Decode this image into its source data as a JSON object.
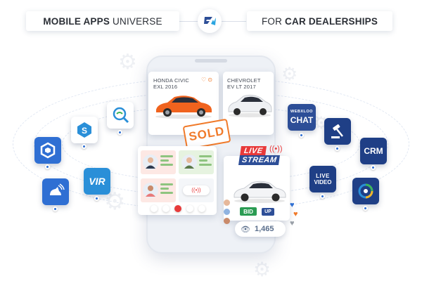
{
  "header": {
    "left_bold": "MOBILE APPS",
    "left_thin": "UNIVERSE",
    "right_thin": "FOR",
    "right_bold": "CAR DEALERSHIPS",
    "logo_icon": "brand-logo-icon"
  },
  "listings": [
    {
      "make": "HONDA CIVIC",
      "model": "EXL 2016",
      "car_color": "#f0631e"
    },
    {
      "make": "CHEVROLET",
      "model": "EV LT 2017",
      "car_color": "#f2f4f7"
    }
  ],
  "sold_stamp": "SOLD",
  "live_stream": {
    "line1": "LIVE",
    "line2": "STREAM",
    "bid_label": "BID",
    "up_label": "UP",
    "viewer_count": "1,465"
  },
  "apps_left": [
    {
      "name": "service-app-icon",
      "bg": "#ffffff"
    },
    {
      "name": "search-app-icon",
      "bg": "#ffffff"
    },
    {
      "name": "cube-app-icon",
      "bg": "#2f6fd3"
    },
    {
      "name": "vir-app-icon",
      "bg": "#2a8fd8",
      "text": "VIR"
    },
    {
      "name": "dimcards-app-icon",
      "bg": "#2f6fd3"
    }
  ],
  "apps_right": [
    {
      "name": "webxloo-chat-app-icon",
      "bg": "#2d4e97",
      "text_top": "WEBXLOO",
      "text_main": "CHAT"
    },
    {
      "name": "auction-app-icon",
      "bg": "#1f3f86"
    },
    {
      "name": "crm-app-icon",
      "bg": "#1f3f86",
      "text_main": "CRM"
    },
    {
      "name": "live-video-app-icon",
      "bg": "#1f3f86",
      "text_top": "LIVE",
      "text_main": "VIDEO"
    },
    {
      "name": "spectrum-app-icon",
      "bg": "#1f3f86"
    }
  ],
  "colors": {
    "accent_orange": "#f07a2a",
    "brand_blue": "#2f6fd3",
    "chat_green": "#8ec47f",
    "live_red": "#e83a3a"
  }
}
